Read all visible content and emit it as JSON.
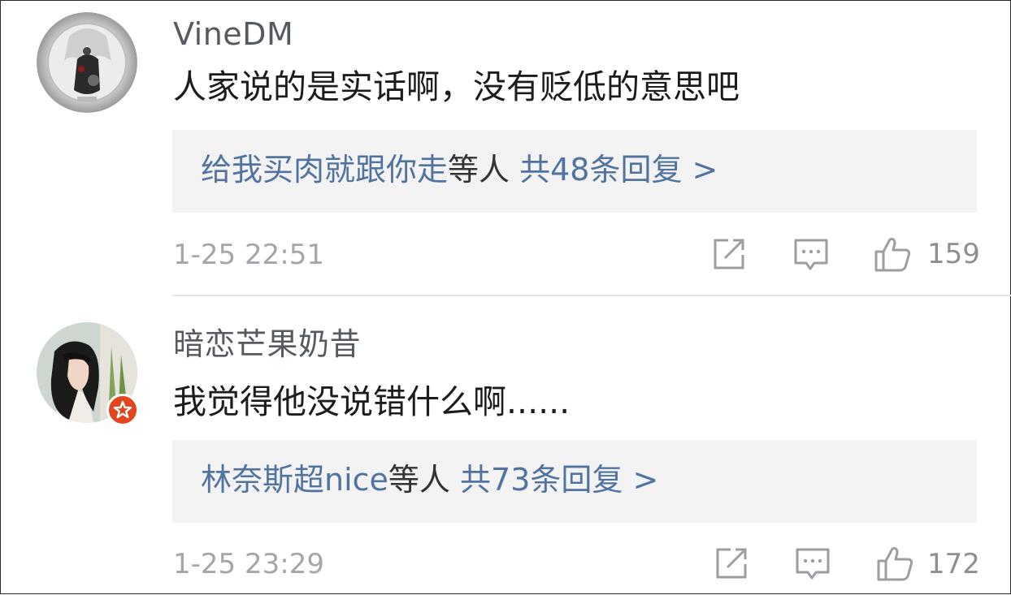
{
  "comments": [
    {
      "username": "VineDM",
      "text": "人家说的是实话啊，没有贬低的意思吧",
      "replies": {
        "names": "给我买肉就跟你走",
        "suffix": "等人",
        "count_text": "共48条回复 >"
      },
      "time": "1-25 22:51",
      "likes": "159",
      "avatar": "anime-character-avatar",
      "verified": false
    },
    {
      "username": "暗恋芒果奶昔",
      "text": "我觉得他没说错什么啊......",
      "replies": {
        "names": "林奈斯超nice",
        "suffix": "等人",
        "count_text": "共73条回复 >"
      },
      "time": "1-25 23:29",
      "likes": "172",
      "avatar": "girl-photo-avatar",
      "verified": true
    }
  ],
  "colors": {
    "link": "#50749f",
    "badge": "#e1461f",
    "reply_bg": "#f3f3f4",
    "meta": "#a3a6aa"
  },
  "icons": [
    "share-edit-icon",
    "comment-icon",
    "thumbs-up-icon",
    "verified-star-icon"
  ]
}
